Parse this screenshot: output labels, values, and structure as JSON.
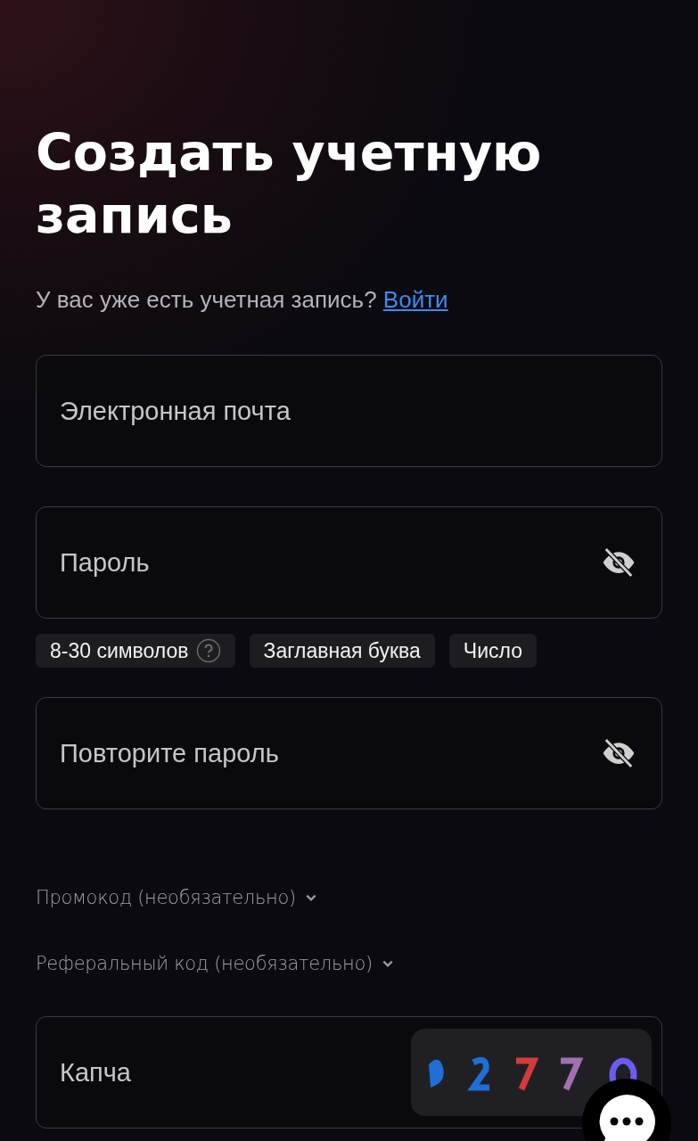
{
  "title": "Создать учетную запись",
  "login_prompt": {
    "text": "У вас уже есть учетная запись?",
    "link": "Войти"
  },
  "fields": [
    {
      "kind": "text",
      "placeholder": "Электронная почта"
    },
    {
      "kind": "password",
      "placeholder": "Пароль"
    }
  ],
  "requirements": [
    {
      "label": "8-30 символов",
      "help": true
    },
    {
      "label": "Заглавная буква",
      "help": false
    },
    {
      "label": "Число",
      "help": false
    }
  ],
  "repeat_field": {
    "kind": "password",
    "placeholder": "Повторите пароль"
  },
  "optional_sections": [
    {
      "label": "Промокод (необязательно)",
      "expanded": false
    },
    {
      "label": "Реферальный код (необязательно)",
      "expanded": false
    }
  ],
  "captcha_field": {
    "placeholder": "Капча"
  }
}
